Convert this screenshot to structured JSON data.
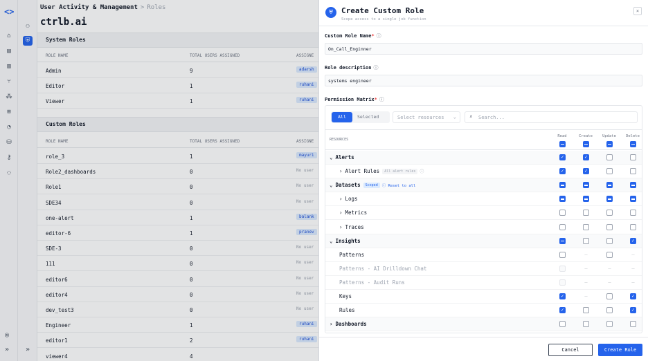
{
  "breadcrumb": {
    "root": "User Activity & Management",
    "sep": ">",
    "current": "Roles"
  },
  "org_name": "ctrlb.ai",
  "system_roles": {
    "title": "System Roles",
    "columns": [
      "ROLE NAME",
      "TOTAL USERS ASSIGNED",
      "ASSIGNE"
    ],
    "rows": [
      {
        "name": "Admin",
        "count": "9",
        "assigned": "adarsh"
      },
      {
        "name": "Editor",
        "count": "1",
        "assigned": "ruhani"
      },
      {
        "name": "Viewer",
        "count": "1",
        "assigned": "ruhani"
      }
    ]
  },
  "custom_roles": {
    "title": "Custom Roles",
    "columns": [
      "ROLE NAME",
      "TOTAL USERS ASSIGNED",
      "ASSIGNE"
    ],
    "rows": [
      {
        "name": "role_3",
        "count": "1",
        "assigned": "mayuri"
      },
      {
        "name": "Role2_dashboards",
        "count": "0",
        "assigned": "No user"
      },
      {
        "name": "Role1",
        "count": "0",
        "assigned": "No user"
      },
      {
        "name": "SDE34",
        "count": "0",
        "assigned": "No user"
      },
      {
        "name": "one-alert",
        "count": "1",
        "assigned": "balank"
      },
      {
        "name": "editor-6",
        "count": "1",
        "assigned": "pranev"
      },
      {
        "name": "SDE-3",
        "count": "0",
        "assigned": "No user"
      },
      {
        "name": "111",
        "count": "0",
        "assigned": "No user"
      },
      {
        "name": "editor6",
        "count": "0",
        "assigned": "No user"
      },
      {
        "name": "editor4",
        "count": "0",
        "assigned": "No user"
      },
      {
        "name": "dev_test3",
        "count": "0",
        "assigned": "No user"
      },
      {
        "name": "Engineer",
        "count": "1",
        "assigned": "ruhani"
      },
      {
        "name": "editor1",
        "count": "2",
        "assigned": "ruhani"
      },
      {
        "name": "viewer4",
        "count": "4",
        "assigned": ""
      }
    ]
  },
  "modal": {
    "title": "Create Custom Role",
    "subtitle": "Scope access to a single job function",
    "close": "×",
    "role_name_label": "Custom Role Name",
    "role_name_value": "On_Call_Enginner",
    "role_desc_label": "Role description",
    "role_desc_value": "systems engineer",
    "matrix_label": "Permission Matrix",
    "filter_all": "All",
    "filter_selected": "Selected",
    "select_resources": "Select resources",
    "search_placeholder": "Search...",
    "resources_header": "RESOURCES",
    "columns": [
      "Read",
      "Create",
      "Update",
      "Delete"
    ],
    "cancel": "Cancel",
    "create": "Create Role"
  },
  "permissions": [
    {
      "label": "Alerts",
      "level": 0,
      "group": true,
      "chev": "v",
      "states": [
        "checked",
        "checked",
        "empty",
        "empty"
      ]
    },
    {
      "label": "Alert Rules",
      "level": 1,
      "chev": ">",
      "tag": "All alert rules",
      "info": true,
      "states": [
        "checked",
        "checked",
        "empty",
        "empty"
      ]
    },
    {
      "label": "Datasets",
      "level": 0,
      "group": true,
      "chev": "v",
      "tagb": "Scoped",
      "reset": "Reset to all",
      "states": [
        "partial",
        "partial",
        "partial",
        "partial"
      ]
    },
    {
      "label": "Logs",
      "level": 1,
      "chev": ">",
      "states": [
        "partial",
        "partial",
        "partial",
        "partial"
      ]
    },
    {
      "label": "Metrics",
      "level": 1,
      "chev": ">",
      "states": [
        "empty",
        "empty",
        "empty",
        "empty"
      ]
    },
    {
      "label": "Traces",
      "level": 1,
      "chev": ">",
      "states": [
        "empty",
        "empty",
        "empty",
        "empty"
      ]
    },
    {
      "label": "Insights",
      "level": 0,
      "group": true,
      "chev": "v",
      "states": [
        "partial",
        "empty",
        "empty",
        "checked"
      ]
    },
    {
      "label": "Patterns",
      "level": 2,
      "states": [
        "empty",
        "na",
        "empty",
        "na"
      ]
    },
    {
      "label": "Patterns - AI Drilldown Chat",
      "level": 2,
      "dim": true,
      "states": [
        "disabled",
        "na",
        "na",
        "na"
      ]
    },
    {
      "label": "Patterns - Audit Runs",
      "level": 2,
      "dim": true,
      "states": [
        "disabled",
        "na",
        "na",
        "na"
      ]
    },
    {
      "label": "Keys",
      "level": 2,
      "states": [
        "checked",
        "na",
        "empty",
        "checked"
      ]
    },
    {
      "label": "Rules",
      "level": 2,
      "states": [
        "checked",
        "empty",
        "empty",
        "checked"
      ]
    },
    {
      "label": "Dashboards",
      "level": 0,
      "group": true,
      "chev": ">",
      "states": [
        "empty",
        "empty",
        "empty",
        "empty"
      ]
    }
  ],
  "header_states": [
    "partial",
    "partial",
    "partial",
    "partial"
  ],
  "colors": {
    "accent": "#2563eb",
    "required": "#ef4444"
  }
}
